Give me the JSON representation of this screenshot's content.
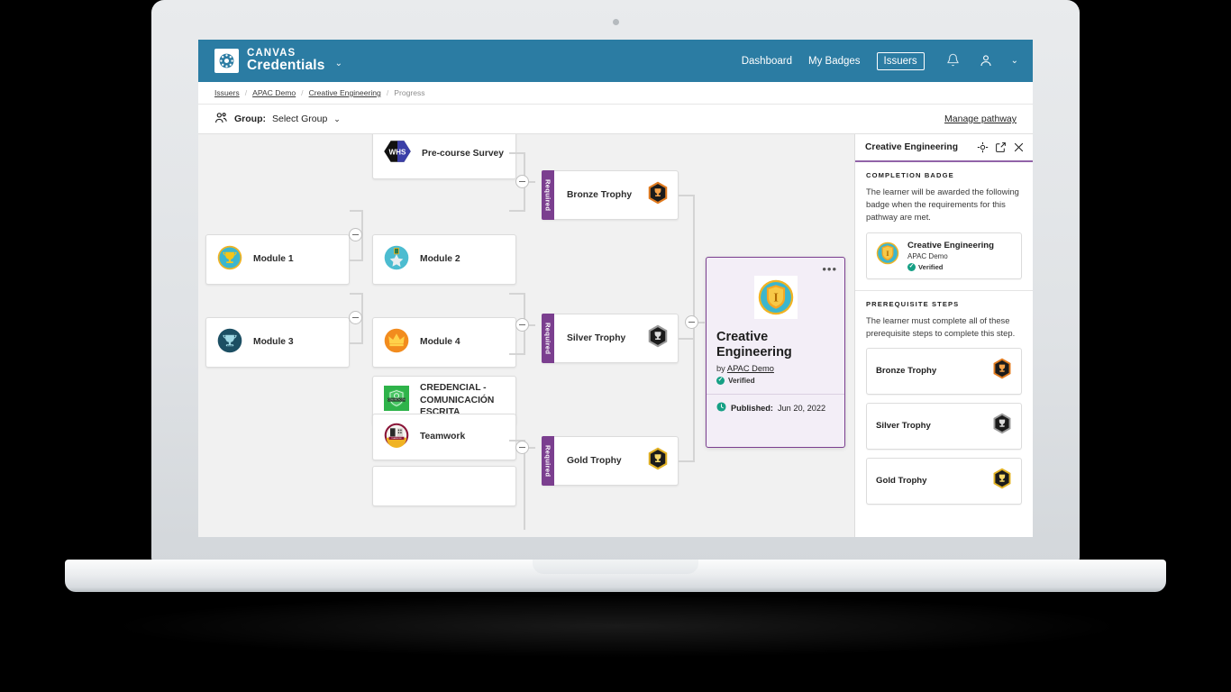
{
  "header": {
    "brand_line1": "CANVAS",
    "brand_line2": "Credentials",
    "brand_caret": "⌄",
    "nav": [
      {
        "label": "Dashboard",
        "boxed": false
      },
      {
        "label": "My Badges",
        "boxed": false
      },
      {
        "label": "Issuers",
        "boxed": true
      }
    ],
    "bell_icon": "bell-icon",
    "account_icon": "account-icon",
    "account_caret": "⌄"
  },
  "breadcrumb": {
    "items": [
      "Issuers",
      "APAC Demo",
      "Creative Engineering"
    ],
    "current": "Progress",
    "separator": "/"
  },
  "toolbar": {
    "group_icon": "group-icon",
    "group_label": "Group:",
    "group_value": "Select Group",
    "group_caret": "⌄",
    "manage_pathway": "Manage pathway"
  },
  "pathway": {
    "modules": [
      {
        "label": "Module 1",
        "icon": "trophy-teal-gold-badge"
      },
      {
        "label": "Module 2",
        "icon": "star-medal-teal-badge"
      },
      {
        "label": "Module 3",
        "icon": "trophy-dark-teal-badge"
      },
      {
        "label": "Module 4",
        "icon": "crown-orange-badge"
      }
    ],
    "items": [
      {
        "label": "Pre-course Survey",
        "icon": "whs-hexagon-badge"
      },
      {
        "label": "CREDENCIAL - COMUNICACIÓN ESCRITA",
        "icon": "green-shield-badge"
      },
      {
        "label": "Teamwork",
        "icon": "teamwork-circular-badge"
      }
    ],
    "required_nodes": [
      {
        "strip": "Required",
        "label": "Bronze Trophy",
        "icon": "bronze-trophy-hex-badge"
      },
      {
        "strip": "Required",
        "label": "Silver Trophy",
        "icon": "silver-trophy-hex-badge"
      },
      {
        "strip": "Required",
        "label": "Gold Trophy",
        "icon": "gold-trophy-hex-badge"
      }
    ]
  },
  "selected_card": {
    "menu_glyph": "•••",
    "badge_icon": "creative-engineering-badge",
    "title": "Creative Engineering",
    "by_prefix": "by",
    "issuer": "APAC Demo",
    "verified": "Verified",
    "published_label": "Published:",
    "published_date": "Jun 20, 2022",
    "clock_icon": "clock-icon"
  },
  "side_panel": {
    "title": "Creative Engineering",
    "actions": [
      {
        "name": "focus-icon"
      },
      {
        "name": "open-external-icon"
      },
      {
        "name": "close-icon"
      }
    ],
    "completion": {
      "heading": "COMPLETION BADGE",
      "description": "The learner will be awarded the following badge when the requirements for this pathway are met.",
      "badge": {
        "title": "Creative Engineering",
        "issuer": "APAC Demo",
        "verified": "Verified",
        "icon": "creative-engineering-badge"
      }
    },
    "prerequisites": {
      "heading": "PREREQUISITE STEPS",
      "description": "The learner must complete all of these prerequisite steps to complete this step.",
      "steps": [
        {
          "label": "Bronze Trophy",
          "icon": "bronze-trophy-hex-badge"
        },
        {
          "label": "Silver Trophy",
          "icon": "silver-trophy-hex-badge"
        },
        {
          "label": "Gold Trophy",
          "icon": "gold-trophy-hex-badge"
        }
      ]
    }
  },
  "colors": {
    "header_blue": "#2b7ca3",
    "required_purple": "#7b3f8f",
    "card_bg": "#f3eef7",
    "verified_green": "#16a085",
    "canvas_bg": "#f1f1f1"
  }
}
